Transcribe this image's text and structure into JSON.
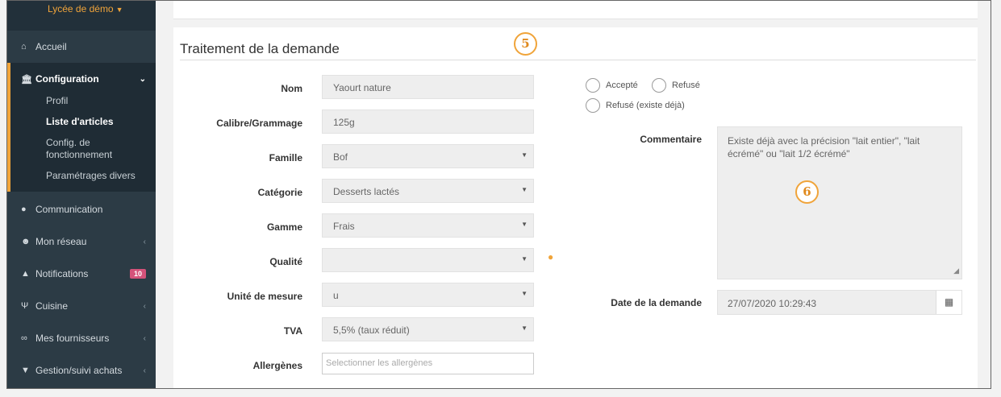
{
  "sidebar": {
    "school": "Lycée de démo",
    "items_top": [
      {
        "label": "Accueil",
        "icon": "home-icon"
      }
    ],
    "config": {
      "label": "Configuration",
      "sub": [
        "Profil",
        "Liste d'articles",
        "Config. de fonctionnement",
        "Paramétrages divers"
      ],
      "active": "Liste d'articles"
    },
    "items": [
      {
        "label": "Communication",
        "icon": "chat-icon"
      },
      {
        "label": "Mon réseau",
        "icon": "users-icon"
      },
      {
        "label": "Notifications",
        "icon": "bell-icon",
        "badge": "10"
      },
      {
        "label": "Cuisine",
        "icon": "cutlery-icon"
      },
      {
        "label": "Mes fournisseurs",
        "icon": "handshake-icon"
      },
      {
        "label": "Gestion/suivi achats",
        "icon": "cart-icon"
      }
    ]
  },
  "panel": {
    "title": "Traitement de la demande",
    "step_a": "5",
    "step_b": "6"
  },
  "form": {
    "nom": {
      "label": "Nom",
      "value": "Yaourt nature"
    },
    "calibre": {
      "label": "Calibre/Grammage",
      "value": "125g"
    },
    "famille": {
      "label": "Famille",
      "value": "Bof"
    },
    "categorie": {
      "label": "Catégorie",
      "value": "Desserts lactés"
    },
    "gamme": {
      "label": "Gamme",
      "value": "Frais"
    },
    "qualite": {
      "label": "Qualité",
      "value": ""
    },
    "unite": {
      "label": "Unité de mesure",
      "value": "u"
    },
    "tva": {
      "label": "TVA",
      "value": "5,5% (taux réduit)"
    },
    "allergenes": {
      "label": "Allergènes",
      "placeholder": "Selectionner les allergènes"
    }
  },
  "decision": {
    "accepte": "Accepté",
    "refuse": "Refusé",
    "refuse_existe": "Refusé (existe déjà)",
    "comment_label": "Commentaire",
    "comment_value": "Existe déjà avec la précision \"lait entier\", \"lait écrémé\" ou \"lait 1/2 écrémé\"",
    "date_label": "Date de la demande",
    "date_value": "27/07/2020 10:29:43"
  },
  "colors": {
    "accent": "#f0a43a",
    "sidebar": "#2c3b45",
    "badge": "#d4527a"
  }
}
